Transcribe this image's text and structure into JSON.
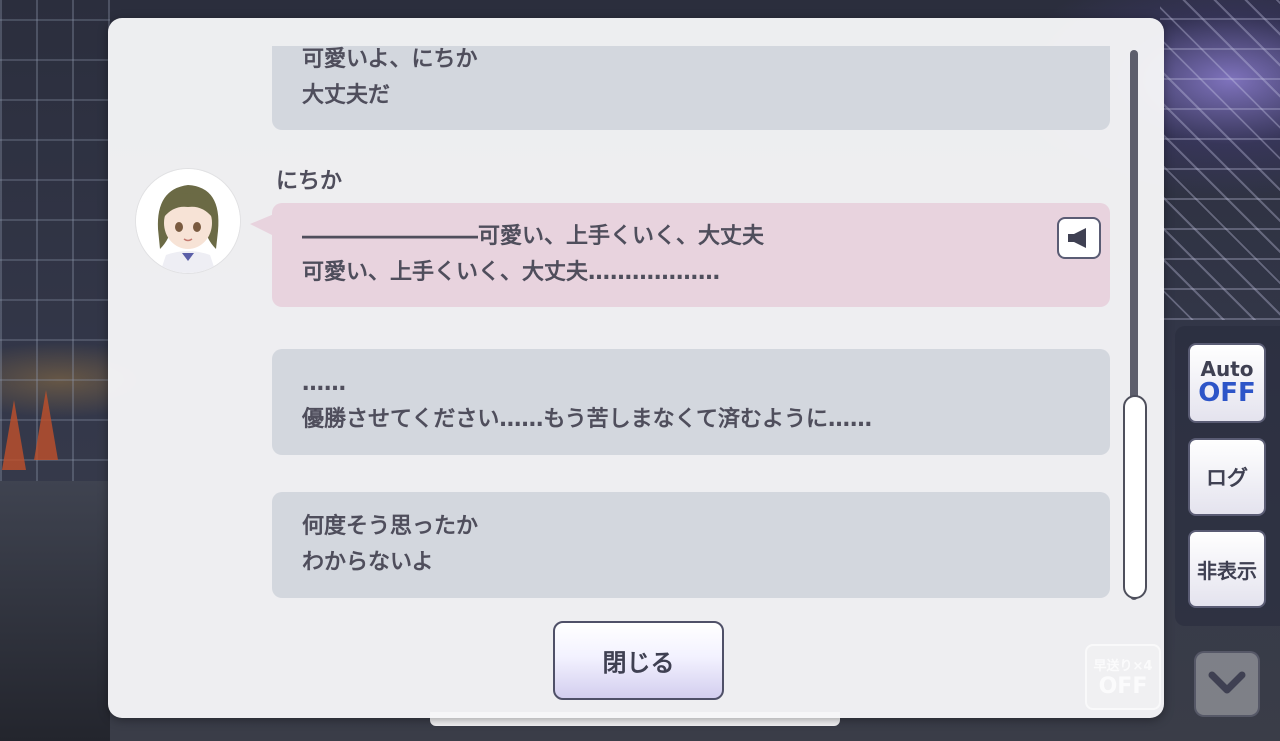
{
  "messages": {
    "top": {
      "lines": [
        "可愛いよ、にちか",
        "大丈夫だ"
      ]
    },
    "nichika": {
      "speaker": "にちか",
      "lines": [
        "――――――――可愛い、上手くいく、大丈夫",
        "可愛い、上手くいく、大丈夫………………"
      ]
    },
    "m3": {
      "lines": [
        "……",
        "優勝させてください……もう苦しまなくて済むように……"
      ]
    },
    "m4": {
      "lines": [
        "何度そう思ったか",
        "わからないよ"
      ]
    }
  },
  "close_button": {
    "label": "閉じる"
  },
  "controls": {
    "auto": {
      "label": "Auto",
      "state": "OFF"
    },
    "log": {
      "label": "ログ"
    },
    "hide": {
      "label": "非表示"
    },
    "skip": {
      "label": "早送り×4",
      "state": "OFF"
    }
  },
  "colors": {
    "panel_bg": "#f6f6f8",
    "message_bg": "#d3d7de",
    "speaker_message_bg": "#e8d3de",
    "text": "#4f4e5c",
    "auto_off": "#2d55c8"
  },
  "icons": {
    "voice": "speaker-icon",
    "down": "chevron-down-icon"
  }
}
